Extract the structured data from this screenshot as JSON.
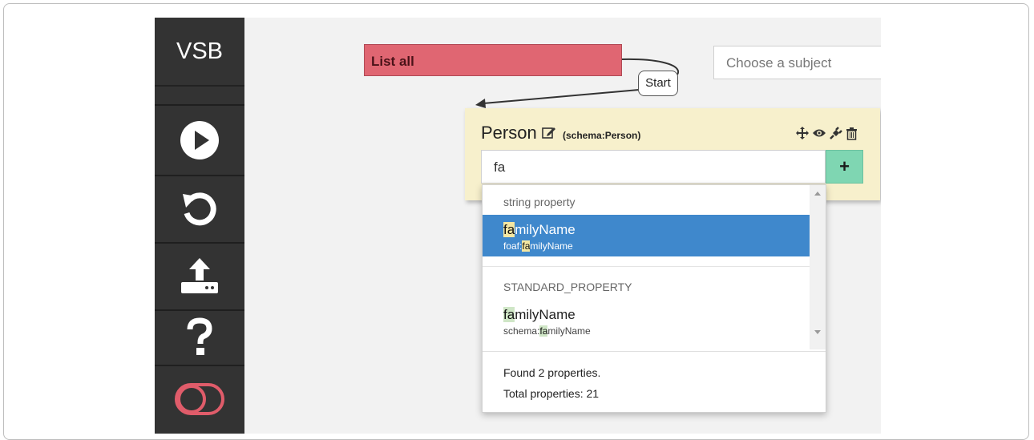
{
  "sidebar": {
    "logo": "VSB",
    "buttons": [
      {
        "icon": "play-icon"
      },
      {
        "icon": "undo-icon"
      },
      {
        "icon": "upload-icon"
      },
      {
        "icon": "help-icon"
      },
      {
        "icon": "toggle-icon"
      }
    ]
  },
  "canvas": {
    "list_all": "List all",
    "start_label": "Start",
    "subject_select": {
      "value": "Choose a subject"
    },
    "subject_add_label": "+"
  },
  "person": {
    "title": "Person",
    "schema": "(schema:Person)",
    "icons": [
      "move-icon",
      "eye-icon",
      "plug-icon",
      "trash-icon",
      "edit-icon"
    ],
    "input_value": "fa",
    "add_label": "+"
  },
  "dropdown": {
    "groups": [
      {
        "header": "string property",
        "item": {
          "name_hl": "fa",
          "name_rest": "milyName",
          "sub_pre": "foaf:",
          "sub_hl": "fa",
          "sub_rest": "milyName"
        }
      },
      {
        "header": "STANDARD_PROPERTY",
        "item": {
          "name_hl": "fa",
          "name_rest": "milyName",
          "sub_pre": "schema:",
          "sub_hl": "fa",
          "sub_rest": "milyName"
        }
      }
    ],
    "found": "Found 2 properties.",
    "total": "Total properties: 21"
  },
  "colors": {
    "sidebar": "#333333",
    "list_all": "#e06672",
    "person_card": "#f7f0cc",
    "add_button": "#7fd6b2",
    "selected_item": "#3f88cc",
    "toggle": "#e05c6a"
  }
}
